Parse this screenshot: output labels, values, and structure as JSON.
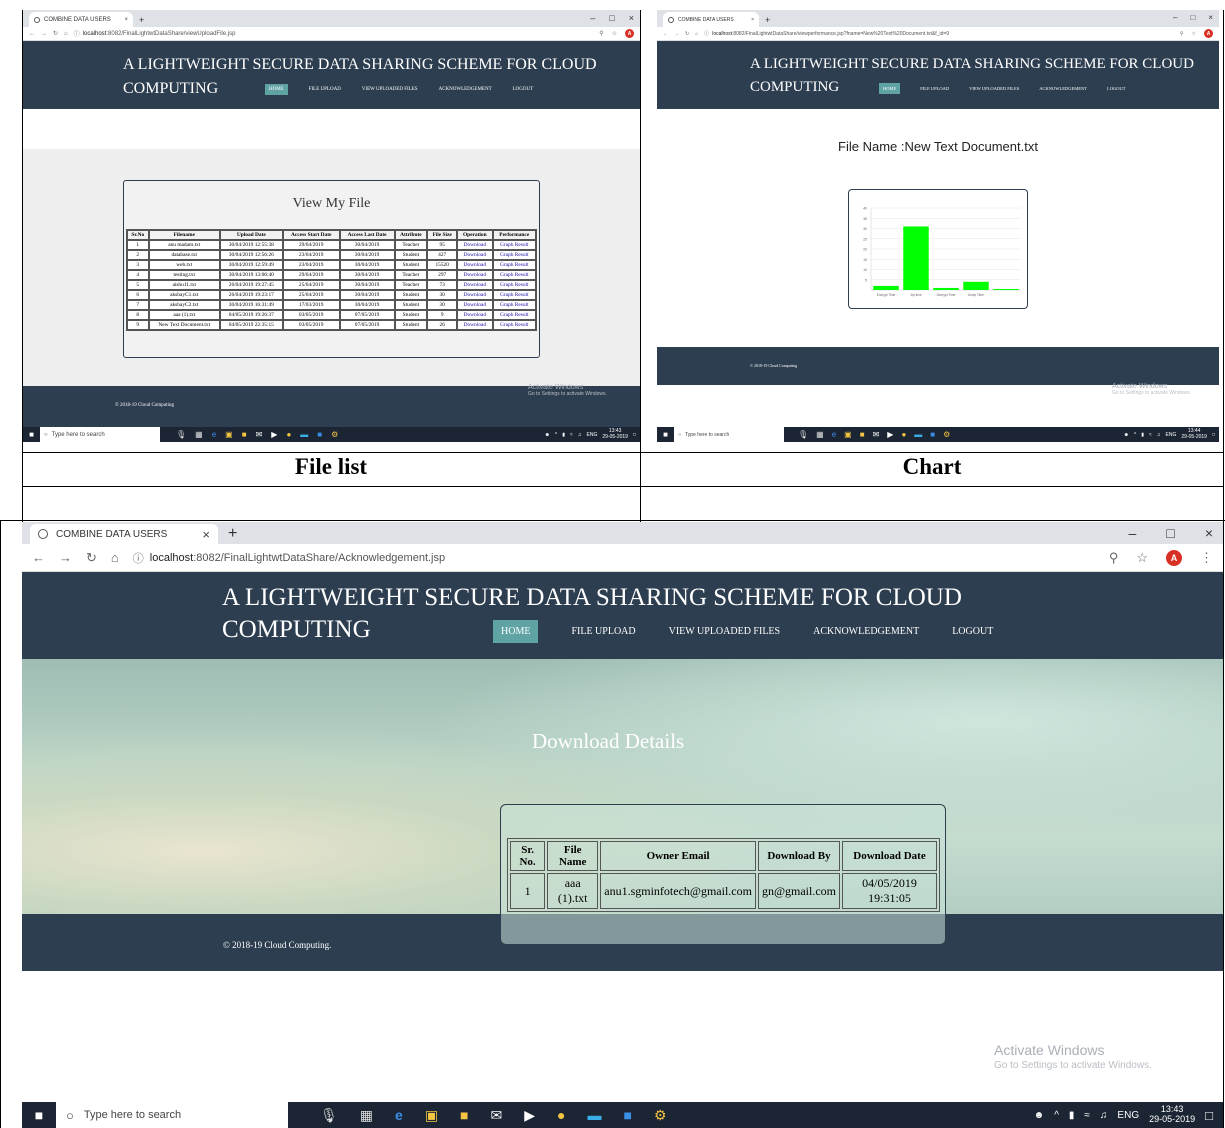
{
  "captions": {
    "file_list": "File list",
    "chart": "Chart"
  },
  "browser": {
    "tab_title": "COMBINE DATA USERS",
    "new_tab": "+",
    "win_min": "–",
    "win_max": "□",
    "win_close": "×",
    "avatar_letter": "A",
    "urls": {
      "top_left": {
        "host": "localhost",
        "rest": ":8082/FinalLightwtDataShare/viewUploadFile.jsp"
      },
      "top_right": {
        "host": "localhost",
        "rest": ":8082/FinalLightwtDataShare/viewperformance.jsp?fname=New%20Text%20Document.txt&f_id=9"
      },
      "bottom": {
        "host": "localhost",
        "rest": ":8082/FinalLightwtDataShare/Acknowledgement.jsp"
      }
    }
  },
  "app": {
    "title_line1": "A LIGHTWEIGHT SECURE DATA SHARING SCHEME FOR CLOUD",
    "title_line2": "COMPUTING",
    "menu": [
      "HOME",
      "FILE UPLOAD",
      "VIEW UPLOADED FILES",
      "ACKNOWLEDGEMENT",
      "LOGOUT"
    ],
    "footer": "© 2018-19 Cloud Computing.",
    "footer_short": "© 2018-19 Cloud Computing"
  },
  "file_list": {
    "heading": "View My File",
    "columns": [
      "Sr.No",
      "Filename",
      "Upload Date",
      "Access Start Date",
      "Access Last Date",
      "Attribute",
      "File Size",
      "Operation",
      "Performance"
    ],
    "rows": [
      [
        "1",
        "anu madam.txt",
        "30/04/2019 12:55:38",
        "29/04/2019",
        "30/04/2019",
        "Teacher",
        "95",
        "Download",
        "Graph Result"
      ],
      [
        "2",
        "database.txt",
        "30/04/2019 12:56:26",
        "23/04/2019",
        "30/04/2019",
        "Student",
        "427",
        "Download",
        "Graph Result"
      ],
      [
        "3",
        "web.txt",
        "30/04/2019 12:59:49",
        "23/04/2019",
        "30/04/2019",
        "Student",
        "15520",
        "Download",
        "Graph Result"
      ],
      [
        "4",
        "testing.txt",
        "30/04/2019 13:06:40",
        "29/04/2019",
        "30/04/2019",
        "Teacher",
        "297",
        "Download",
        "Graph Result"
      ],
      [
        "5",
        "aishu11.txt",
        "26/04/2019 19:27:45",
        "25/04/2019",
        "30/04/2019",
        "Teacher",
        "73",
        "Download",
        "Graph Result"
      ],
      [
        "6",
        "akshayC1.txt",
        "26/04/2019 19:23:17",
        "25/04/2019",
        "30/04/2019",
        "Student",
        "30",
        "Download",
        "Graph Result"
      ],
      [
        "7",
        "akshayC2.txt",
        "30/04/2019 16:31:49",
        "17/03/2019",
        "30/04/2019",
        "Student",
        "30",
        "Download",
        "Graph Result"
      ],
      [
        "8",
        "aaa (1).txt",
        "04/05/2019 19:26:37",
        "03/05/2019",
        "07/05/2019",
        "Student",
        "9",
        "Download",
        "Graph Result"
      ],
      [
        "9",
        "New Text Document.txt",
        "04/05/2019 22:35:15",
        "03/05/2019",
        "07/05/2019",
        "Student",
        "26",
        "Download",
        "Graph Result"
      ]
    ]
  },
  "chart_page": {
    "heading": "File Name :New Text Document.txt"
  },
  "chart_data": {
    "type": "bar",
    "title": "",
    "xlabel": "",
    "ylabel": "",
    "categories": [
      "Encrypt Time",
      "Zip time",
      "Decrypt Time",
      "Unzip Time",
      ""
    ],
    "values": [
      2,
      31,
      1,
      4,
      0.5
    ],
    "ylim": [
      0,
      40
    ],
    "yticks": [
      5,
      10,
      15,
      20,
      25,
      30,
      35,
      40
    ],
    "grid": true,
    "bar_color": "#00ff00"
  },
  "download_page": {
    "heading": "Download Details",
    "columns": [
      "Sr. No.",
      "File Name",
      "Owner Email",
      "Download By",
      "Download Date"
    ],
    "rows": [
      [
        "1",
        "aaa (1).txt",
        "anu1.sgminfotech@gmail.com",
        "gn@gmail.com",
        "04/05/2019 19:31:05"
      ]
    ]
  },
  "windows": {
    "activate_title": "Activate Windows",
    "activate_sub": "Go to Settings to activate Windows.",
    "search_placeholder": "Type here to search",
    "lang": "ENG",
    "times": {
      "top_left": {
        "time": "13:43",
        "date": "29-05-2019"
      },
      "top_right": {
        "time": "13:44",
        "date": "29-05-2019"
      },
      "bottom": {
        "time": "13:43",
        "date": "29-05-2019"
      }
    }
  }
}
